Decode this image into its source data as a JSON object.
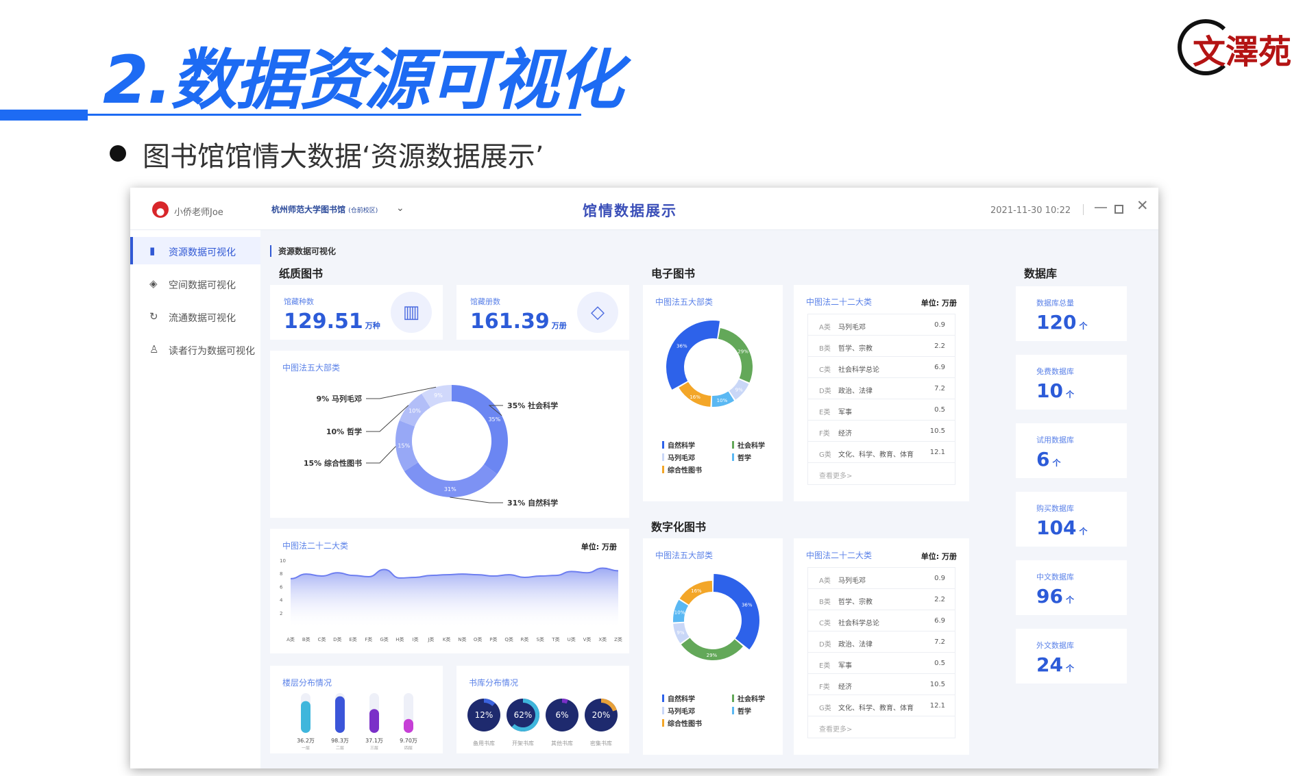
{
  "slide": {
    "title": "2.数据资源可视化",
    "bullet": "图书馆馆情大数据‘资源数据展示’",
    "logo_text": "文澤苑"
  },
  "app": {
    "user": "小侨老师Joe",
    "library": "杭州师范大学图书馆",
    "library_campus": "(仓前校区)",
    "title": "馆情数据展示",
    "datetime": "2021-11-30  10:22",
    "sidebar": [
      {
        "label": "资源数据可视化",
        "icon": "chart-bar-icon",
        "active": true
      },
      {
        "label": "空间数据可视化",
        "icon": "cube-icon",
        "active": false
      },
      {
        "label": "流通数据可视化",
        "icon": "refresh-icon",
        "active": false
      },
      {
        "label": "读者行为数据可视化",
        "icon": "user-icon",
        "active": false
      }
    ],
    "breadcrumb": "资源数据可视化"
  },
  "paper": {
    "section": "纸质图书",
    "stat1": {
      "label": "馆藏种数",
      "value": "129.51",
      "unit": "万种",
      "icon": "bar-chart-icon"
    },
    "stat2": {
      "label": "馆藏册数",
      "value": "161.39",
      "unit": "万册",
      "icon": "layers-icon"
    },
    "five_title": "中图法五大部类",
    "five": [
      {
        "name": "社会科学",
        "value": 35,
        "label": "35%",
        "pct": "35%"
      },
      {
        "name": "自然科学",
        "value": 31,
        "label": "31%",
        "pct": "31%"
      },
      {
        "name": "综合性图书",
        "value": 15,
        "label": "15%",
        "pct": "15%"
      },
      {
        "name": "哲学",
        "value": 10,
        "label": "10%",
        "pct": "10%"
      },
      {
        "name": "马列毛邓",
        "value": 9,
        "label": "9%",
        "pct": "9%"
      }
    ],
    "colors": [
      "#6b86f2",
      "#7d92f4",
      "#97a8f6",
      "#b2bef8",
      "#d0d8fb"
    ],
    "line_title": "中图法二十二大类",
    "line_unit": "单位: 万册",
    "floor_title": "楼层分布情况",
    "floors": [
      {
        "value": "36.2万",
        "sub": "一层",
        "fill": 0.8,
        "color": "#3fb6dc"
      },
      {
        "value": "98.3万",
        "sub": "二层",
        "fill": 0.92,
        "color": "#3b55d9"
      },
      {
        "value": "37.1万",
        "sub": "三层",
        "fill": 0.6,
        "color": "#7b30c8"
      },
      {
        "value": "9.70万",
        "sub": "四层",
        "fill": 0.35,
        "color": "#c63fd6"
      }
    ],
    "lib_title": "书库分布情况",
    "libs": [
      {
        "pct": "12%",
        "name": "备用书库",
        "fill": 0.12,
        "color": "#3c64e0"
      },
      {
        "pct": "62%",
        "name": "开架书库",
        "fill": 0.62,
        "color": "#3fb6dc"
      },
      {
        "pct": "6%",
        "name": "其他书库",
        "fill": 0.06,
        "color": "#7b30c8"
      },
      {
        "pct": "20%",
        "name": "密集书库",
        "fill": 0.2,
        "color": "#e8a13a"
      }
    ]
  },
  "chart_data": [
    {
      "type": "pie",
      "title": "中图法五大部类",
      "categories": [
        "社会科学",
        "自然科学",
        "综合性图书",
        "哲学",
        "马列毛邓"
      ],
      "values": [
        35,
        31,
        15,
        10,
        9
      ]
    },
    {
      "type": "area",
      "title": "中图法二十二大类",
      "ylabel": "单位: 万册",
      "categories": [
        "A类",
        "B类",
        "C类",
        "D类",
        "E类",
        "F类",
        "G类",
        "H类",
        "I类",
        "J类",
        "K类",
        "N类",
        "O类",
        "P类",
        "Q类",
        "R类",
        "S类",
        "T类",
        "U类",
        "V类",
        "X类",
        "Z类"
      ],
      "values": [
        7.2,
        7.9,
        7.6,
        8.1,
        7.7,
        7.5,
        8.6,
        7.3,
        7.4,
        7.7,
        7.8,
        7.9,
        7.8,
        7.6,
        7.8,
        7.4,
        7.6,
        7.7,
        8.3,
        8.1,
        8.8,
        8.4
      ],
      "ylim": [
        0,
        10
      ],
      "yticks": [
        10,
        8,
        6,
        4,
        2
      ]
    },
    {
      "type": "pie",
      "title": "电子图书 中图法五大部类",
      "categories": [
        "自然科学",
        "社会科学",
        "马列毛邓",
        "哲学",
        "综合性图书"
      ],
      "values": [
        36,
        29,
        9,
        10,
        16
      ]
    },
    {
      "type": "pie",
      "title": "数字化图书 中图法五大部类",
      "categories": [
        "自然科学",
        "社会科学",
        "马列毛邓",
        "哲学",
        "综合性图书"
      ],
      "values": [
        36,
        29,
        9,
        10,
        16
      ]
    }
  ],
  "ebook": {
    "section": "电子图书",
    "five_title": "中图法五大部类",
    "five_labels": [
      "36%",
      "10%",
      "9%",
      "16%",
      "29%"
    ],
    "twentytwo_title": "中图法二十二大类",
    "unit": "单位: 万册",
    "rows": [
      {
        "code": "A类",
        "name": "马列毛邓",
        "val": "0.9"
      },
      {
        "code": "B类",
        "name": "哲学、宗教",
        "val": "2.2"
      },
      {
        "code": "C类",
        "name": "社会科学总论",
        "val": "6.9"
      },
      {
        "code": "D类",
        "name": "政治、法律",
        "val": "7.2"
      },
      {
        "code": "E类",
        "name": "军事",
        "val": "0.5"
      },
      {
        "code": "F类",
        "name": "经济",
        "val": "10.5"
      },
      {
        "code": "G类",
        "name": "文化、科学、教育、体育",
        "val": "12.1"
      }
    ],
    "more": "查看更多>",
    "legend": [
      {
        "name": "自然科学",
        "color": "#2d62ea"
      },
      {
        "name": "社会科学",
        "color": "#63a859"
      },
      {
        "name": "马列毛邓",
        "color": "#c9d7f7"
      },
      {
        "name": "哲学",
        "color": "#5ab8f3"
      },
      {
        "name": "综合性图书",
        "color": "#f3a628"
      }
    ]
  },
  "digital": {
    "section": "数字化图书",
    "five_title": "中图法五大部类",
    "five_labels": [
      "29%",
      "36%",
      "10%",
      "9%",
      "16%"
    ],
    "twentytwo_title": "中图法二十二大类",
    "unit": "单位: 万册"
  },
  "database": {
    "section": "数据库",
    "items": [
      {
        "label": "数据库总量",
        "value": "120",
        "unit": "个"
      },
      {
        "label": "免费数据库",
        "value": "10",
        "unit": "个"
      },
      {
        "label": "试用数据库",
        "value": "6",
        "unit": "个"
      },
      {
        "label": "购买数据库",
        "value": "104",
        "unit": "个"
      },
      {
        "label": "中文数据库",
        "value": "96",
        "unit": "个"
      },
      {
        "label": "外文数据库",
        "value": "24",
        "unit": "个"
      }
    ]
  }
}
